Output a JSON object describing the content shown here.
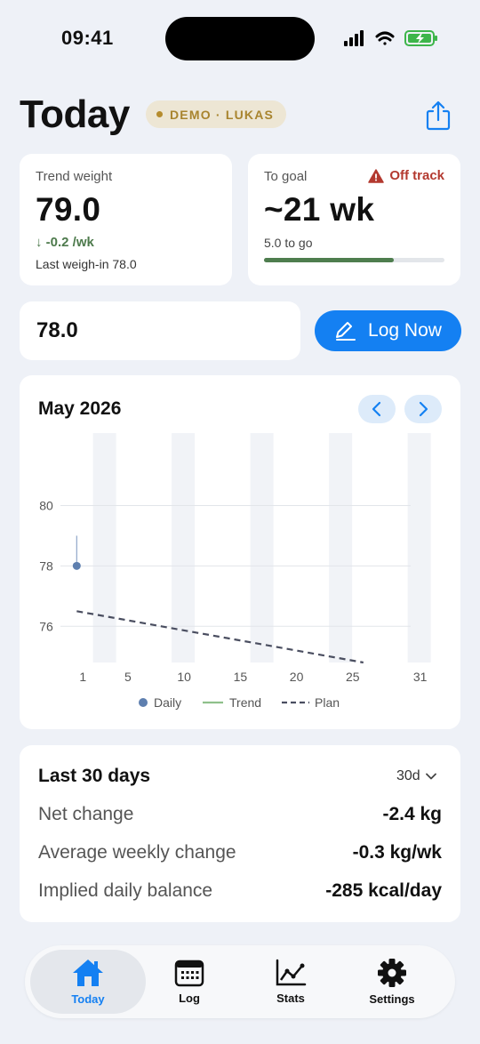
{
  "status_bar": {
    "time": "09:41"
  },
  "header": {
    "title": "Today",
    "demo_badge": "DEMO · LUKAS"
  },
  "trend_card": {
    "label": "Trend weight",
    "value": "79.0",
    "rate": "↓ -0.2 /wk",
    "last_weigh_in": "Last weigh-in 78.0"
  },
  "goal_card": {
    "label": "To goal",
    "status": "Off track",
    "value": "~21 wk",
    "remaining": "5.0 to go",
    "progress_fraction": 0.72
  },
  "log": {
    "input_value": "78.0",
    "button_label": "Log Now"
  },
  "chart": {
    "month_label": "May 2026",
    "legend": {
      "daily": "Daily",
      "trend": "Trend",
      "plan": "Plan"
    }
  },
  "chart_data": {
    "type": "line",
    "x_ticks": [
      "1",
      "5",
      "10",
      "15",
      "20",
      "25",
      "31"
    ],
    "y_ticks": [
      "80",
      "78",
      "76"
    ],
    "xlim": [
      0,
      31
    ],
    "ylim": [
      74.8,
      82.4
    ],
    "grid": true,
    "legend_placement": "bottom",
    "series": [
      {
        "name": "Daily",
        "points": [
          [
            0.5,
            78
          ]
        ],
        "range": [
          78,
          79
        ],
        "color": "#5E7FAF"
      },
      {
        "name": "Trend",
        "points": [],
        "color": "#8FC08B"
      },
      {
        "name": "Plan",
        "points": [
          [
            0.5,
            76.5
          ],
          [
            26,
            74.8
          ]
        ],
        "color": "#4A4E60",
        "dashed": true
      }
    ]
  },
  "stats": {
    "title": "Last 30 days",
    "range": "30d",
    "rows": [
      {
        "label": "Net change",
        "value": "-2.4 kg"
      },
      {
        "label": "Average weekly change",
        "value": "-0.3 kg/wk"
      },
      {
        "label": "Implied daily balance",
        "value": "-285 kcal/day"
      }
    ]
  },
  "tabs": [
    {
      "label": "Today",
      "icon": "home-icon"
    },
    {
      "label": "Log",
      "icon": "calendar-icon"
    },
    {
      "label": "Stats",
      "icon": "chart-icon"
    },
    {
      "label": "Settings",
      "icon": "gear-icon"
    }
  ]
}
